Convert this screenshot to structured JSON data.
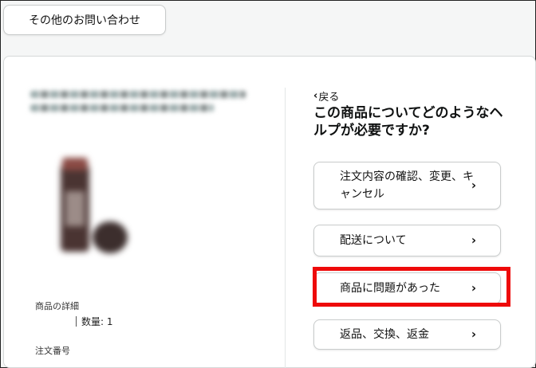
{
  "top_button": {
    "label": "その他のお問い合わせ"
  },
  "product": {
    "detail_label": "商品の詳細",
    "quantity_text": "数量: 1",
    "order_number_label": "注文番号"
  },
  "help": {
    "back_label": "戻る",
    "title": "この商品についてどのようなヘルプが必要ですか?",
    "options": [
      {
        "label": "注文内容の確認、変更、キャンセル"
      },
      {
        "label": "配送について"
      },
      {
        "label": "商品に問題があった"
      },
      {
        "label": "返品、交換、返金"
      }
    ]
  },
  "colors": {
    "highlight": "#ee0a0a",
    "border": "#c9cccc"
  }
}
